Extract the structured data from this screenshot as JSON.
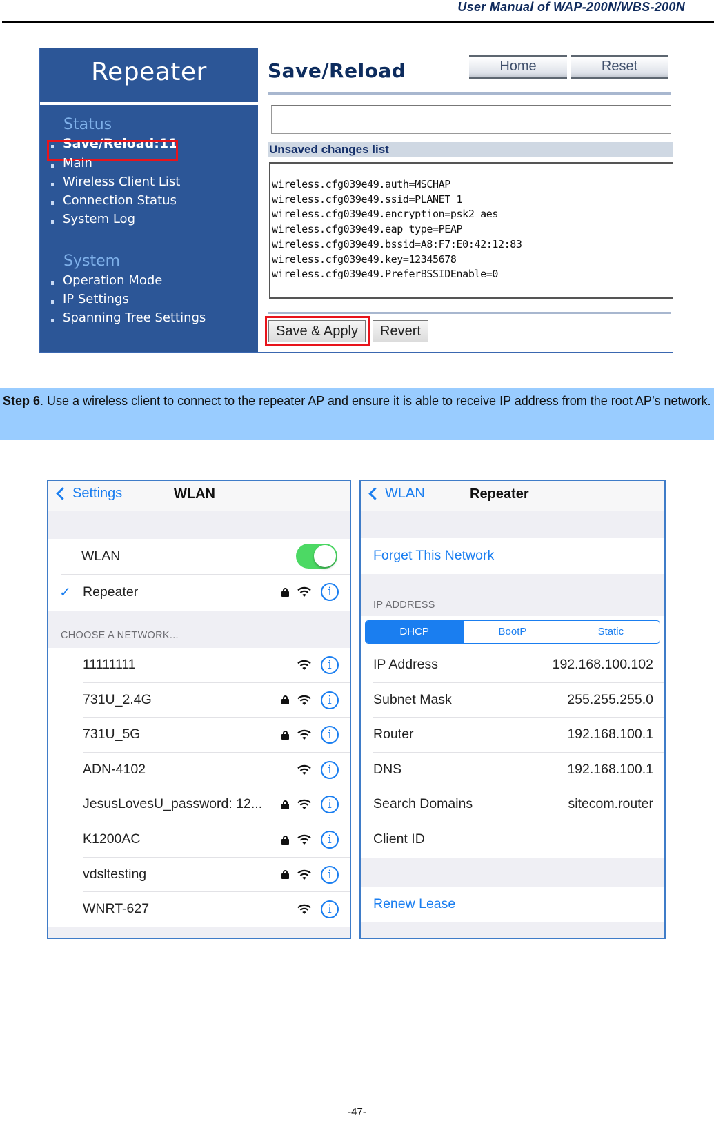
{
  "header": {
    "title": "User  Manual  of  WAP-200N/WBS-200N"
  },
  "router_ui": {
    "brand": "Repeater",
    "sections": [
      {
        "title": "Status",
        "items": [
          "Save/Reload:11",
          "Main",
          "Wireless Client List",
          "Connection Status",
          "System Log"
        ]
      },
      {
        "title": "System",
        "items": [
          "Operation Mode",
          "IP Settings",
          "Spanning Tree Settings"
        ]
      }
    ],
    "active_item": "Save/Reload:11",
    "page_title": "Save/Reload",
    "top_buttons": [
      "Home",
      "Reset"
    ],
    "message_box_value": "",
    "list_header": "Unsaved changes list",
    "changes": [
      "wireless.cfg039e49.auth=MSCHAP",
      "wireless.cfg039e49.ssid=PLANET 1",
      "wireless.cfg039e49.encryption=psk2 aes",
      "wireless.cfg039e49.eap_type=PEAP",
      "wireless.cfg039e49.bssid=A8:F7:E0:42:12:83",
      "wireless.cfg039e49.key=12345678",
      "wireless.cfg039e49.PreferBSSIDEnable=0"
    ],
    "actions": {
      "apply": "Save & Apply",
      "revert": "Revert"
    },
    "highlight_color": "#e8141b",
    "sidebar_color": "#2c5697"
  },
  "step": {
    "label": "Step 6",
    "text": ". Use a wireless client to connect to the repeater AP and ensure it is able to receive IP address from the root AP’s network."
  },
  "wlan_screen": {
    "back_label": "Settings",
    "title": "WLAN",
    "toggle_label": "WLAN",
    "toggle_on": true,
    "connected_network": {
      "name": "Repeater",
      "locked": true
    },
    "choose_header": "CHOOSE A NETWORK...",
    "networks": [
      {
        "name": "11111111",
        "locked": false
      },
      {
        "name": "731U_2.4G",
        "locked": true
      },
      {
        "name": "731U_5G",
        "locked": true
      },
      {
        "name": "ADN-4102",
        "locked": false
      },
      {
        "name": "JesusLovesU_password: 12...",
        "locked": true
      },
      {
        "name": "K1200AC",
        "locked": true
      },
      {
        "name": "vdsltesting",
        "locked": true
      },
      {
        "name": "WNRT-627",
        "locked": false
      }
    ],
    "accent_color": "#1a7ef0",
    "toggle_color": "#4cd964"
  },
  "detail_screen": {
    "back_label": "WLAN",
    "title": "Repeater",
    "forget_label": "Forget This Network",
    "ip_header": "IP ADDRESS",
    "segments": [
      "DHCP",
      "BootP",
      "Static"
    ],
    "selected_segment": "DHCP",
    "rows": [
      {
        "label": "IP Address",
        "value": "192.168.100.102"
      },
      {
        "label": "Subnet Mask",
        "value": "255.255.255.0"
      },
      {
        "label": "Router",
        "value": "192.168.100.1"
      },
      {
        "label": "DNS",
        "value": "192.168.100.1"
      },
      {
        "label": "Search Domains",
        "value": "sitecom.router"
      },
      {
        "label": "Client ID",
        "value": ""
      }
    ],
    "renew_label": "Renew Lease"
  },
  "footer": {
    "page_number": "-47-"
  }
}
